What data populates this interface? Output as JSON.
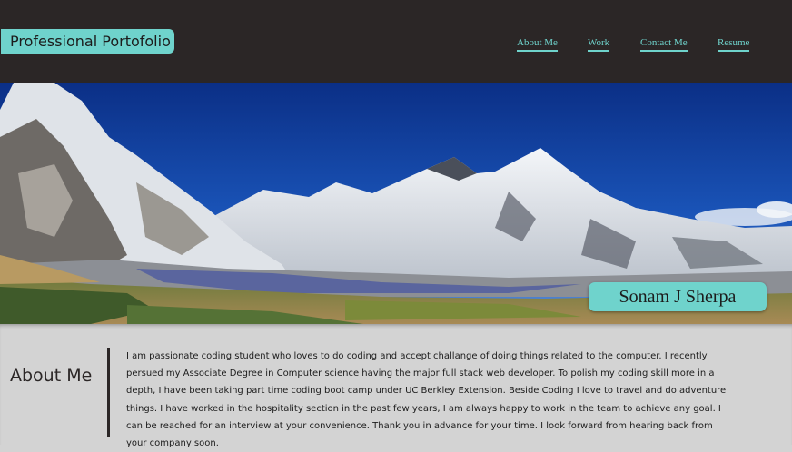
{
  "header": {
    "brand": "Professional Portofolio",
    "nav": [
      {
        "label": "About Me"
      },
      {
        "label": "Work"
      },
      {
        "label": "Contact Me"
      },
      {
        "label": "Resume"
      }
    ]
  },
  "hero": {
    "name": "Sonam J Sherpa"
  },
  "about": {
    "title": "About Me",
    "text": "I am passionate coding student who loves to do coding and accept challange of doing things related to the computer. I recently persued my Associate Degree in Computer science having the major full stack web developer. To polish my coding skill more in a depth, I have been taking part time coding boot camp under UC Berkley Extension. Beside Coding I love to travel and do adventure things. I have worked in the hospitality section in the past few years, I am always happy to work in the team to achieve any goal. I can be reached for an interview at your convenience. Thank you in advance for your time. I look forward from hearing back from your company soon."
  },
  "colors": {
    "header_bg": "#2b2626",
    "accent": "#6fd3cc",
    "section_bg": "#d3d3d3"
  }
}
